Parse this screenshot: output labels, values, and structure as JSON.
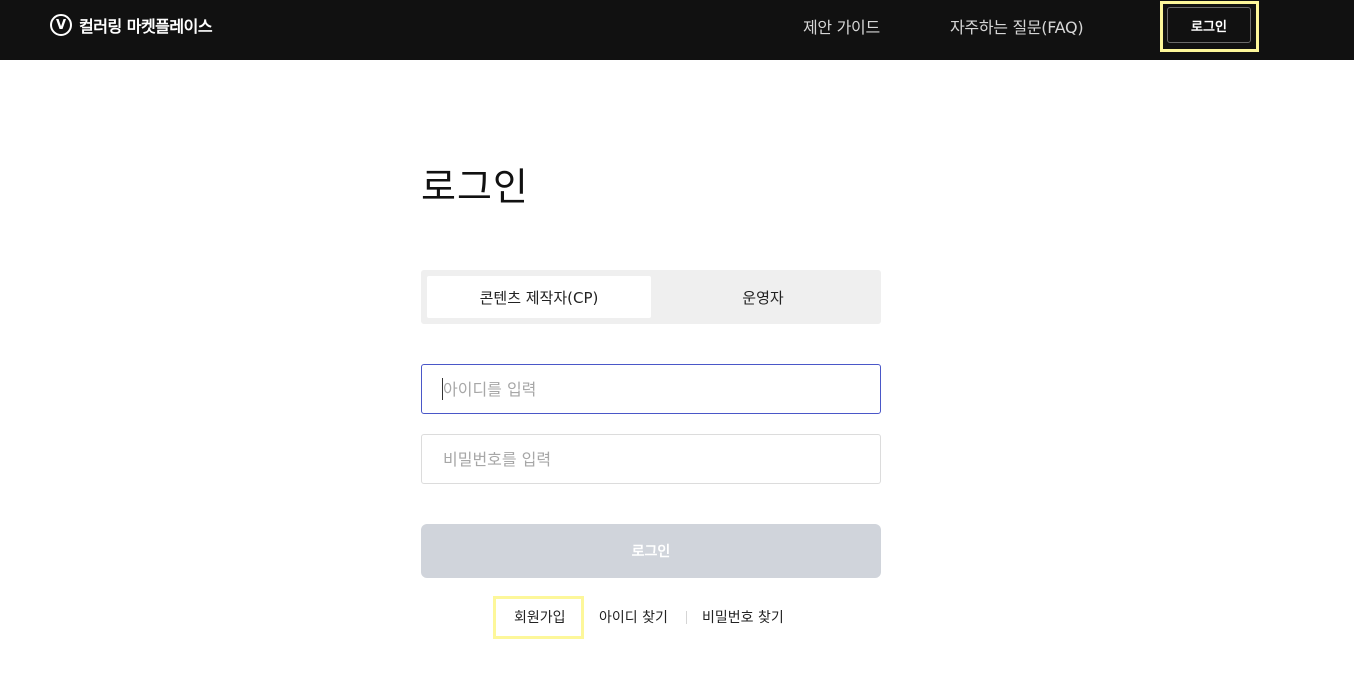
{
  "header": {
    "logo_mark": "V",
    "brand": "컬러링 마켓플레이스",
    "nav": {
      "guide": "제안 가이드",
      "faq": "자주하는 질문(FAQ)"
    },
    "login_button": "로그인"
  },
  "main": {
    "title": "로그인",
    "tabs": [
      {
        "label": "콘텐츠 제작자(CP)",
        "selected": true
      },
      {
        "label": "운영자",
        "selected": false
      }
    ],
    "id_input": {
      "placeholder": "아이디를 입력",
      "value": ""
    },
    "password_input": {
      "placeholder": "비밀번호를 입력",
      "value": ""
    },
    "login_button": "로그인",
    "links": {
      "signup": "회원가입",
      "find_id": "아이디 찾기",
      "find_password": "비밀번호 찾기"
    }
  },
  "colors": {
    "header_bg": "#111111",
    "highlight": "#fdf79a",
    "active_input_border": "#4a57c8",
    "disabled_button_bg": "#d0d4db",
    "tab_bg": "#efefef"
  }
}
